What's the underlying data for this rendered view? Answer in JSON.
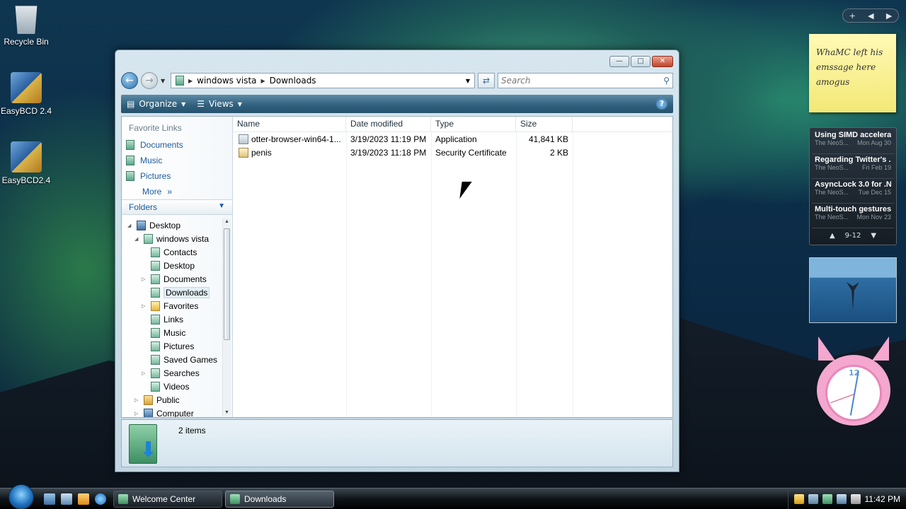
{
  "desktop": {
    "icons": [
      {
        "label": "Recycle Bin"
      },
      {
        "label": "EasyBCD 2.4"
      },
      {
        "label": "EasyBCD2.4"
      }
    ]
  },
  "window": {
    "breadcrumb": [
      "windows vista",
      "Downloads"
    ],
    "search_placeholder": "Search",
    "toolbar": {
      "organize": "Organize",
      "views": "Views"
    },
    "favorite_links_title": "Favorite Links",
    "favorites": [
      "Documents",
      "Music",
      "Pictures"
    ],
    "more_label": "More",
    "folders_label": "Folders",
    "tree": [
      {
        "label": "Desktop",
        "level": 0
      },
      {
        "label": "windows vista",
        "level": 1
      },
      {
        "label": "Contacts",
        "level": 2
      },
      {
        "label": "Desktop",
        "level": 2
      },
      {
        "label": "Documents",
        "level": 2
      },
      {
        "label": "Downloads",
        "level": 2
      },
      {
        "label": "Favorites",
        "level": 2
      },
      {
        "label": "Links",
        "level": 2
      },
      {
        "label": "Music",
        "level": 2
      },
      {
        "label": "Pictures",
        "level": 2
      },
      {
        "label": "Saved Games",
        "level": 2
      },
      {
        "label": "Searches",
        "level": 2
      },
      {
        "label": "Videos",
        "level": 2
      },
      {
        "label": "Public",
        "level": 1
      },
      {
        "label": "Computer",
        "level": 1
      }
    ],
    "columns": {
      "name": "Name",
      "date": "Date modified",
      "type": "Type",
      "size": "Size"
    },
    "files": [
      {
        "name": "otter-browser-win64-1...",
        "date": "3/19/2023 11:19 PM",
        "type": "Application",
        "size": "41,841 KB"
      },
      {
        "name": "penis",
        "date": "3/19/2023 11:18 PM",
        "type": "Security Certificate",
        "size": "2 KB"
      }
    ],
    "details_count": "2 items"
  },
  "sidebar": {
    "note": "WhaMC left his emssage here amogus",
    "feeds": [
      {
        "title": "Using SIMD accelera...",
        "source": "The NeoS...",
        "date": "Mon Aug 30"
      },
      {
        "title": "Regarding Twitter's ...",
        "source": "The NeoS...",
        "date": "Fri Feb 19"
      },
      {
        "title": "AsyncLock 3.0 for .N...",
        "source": "The NeoS...",
        "date": "Tue Dec 15"
      },
      {
        "title": "Multi-touch gestures...",
        "source": "The NeoS...",
        "date": "Mon Nov 23"
      }
    ],
    "feed_page": "9-12",
    "clock_12": "12"
  },
  "taskbar": {
    "tasks": [
      "Welcome Center",
      "Downloads"
    ],
    "time": "11:42 PM"
  }
}
